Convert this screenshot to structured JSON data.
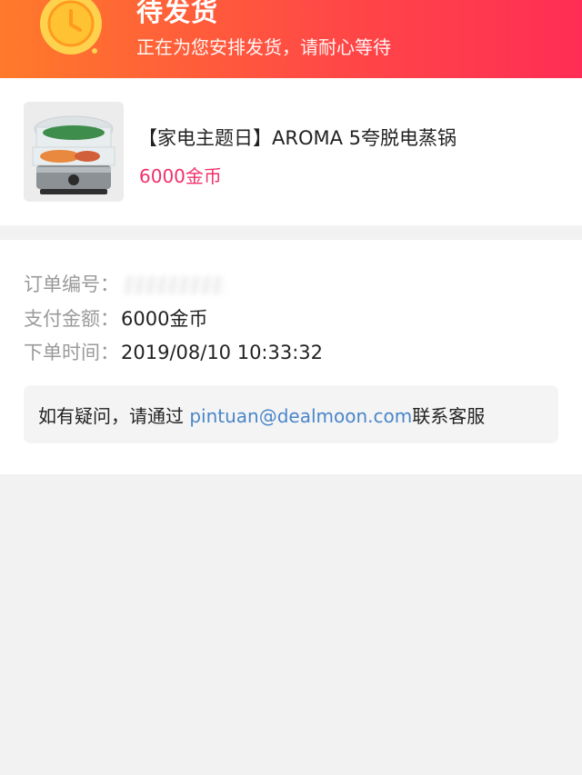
{
  "header": {
    "status_title": "待发货",
    "status_subtitle": "正在为您安排发货，请耐心等待",
    "status_icon": "clock-icon",
    "gradient_start": "#ff7a2a",
    "gradient_end": "#ff2d55"
  },
  "product": {
    "title": "【家电主题日】AROMA 5夸脱电蒸锅",
    "price": "6000金币",
    "price_color": "#f1306a",
    "image_icon": "food-steamer-image"
  },
  "order": {
    "number_label": "订单编号：",
    "amount_label": "支付金额：",
    "amount_value": "6000金币",
    "time_label": "下单时间：",
    "time_value": "2019/08/10  10:33:32"
  },
  "help": {
    "prefix": "如有疑问，请通过 ",
    "email": "pintuan@dealmoon.com",
    "suffix": "联系客服",
    "link_color": "#4a86c8"
  }
}
